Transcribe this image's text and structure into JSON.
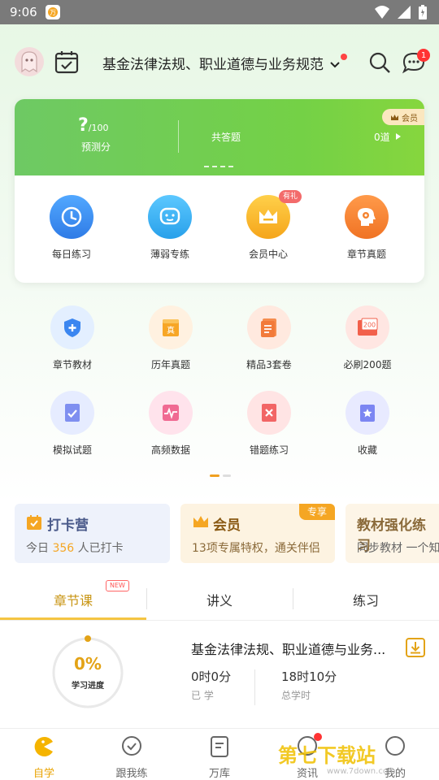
{
  "status_bar": {
    "time": "9:06"
  },
  "header": {
    "subject": "基金法律法规、职业道德与业务规范",
    "message_badge": "1"
  },
  "exam_card": {
    "score": "?",
    "score_max": "/100",
    "score_label": "预测分",
    "answered_label": "共答题",
    "answered_count": "0道",
    "vip_tag": "会员",
    "accent": "#74d146"
  },
  "quick_actions": [
    {
      "label": "每日练习",
      "icon": "clock-icon",
      "color": "#3a8ff0"
    },
    {
      "label": "薄弱专练",
      "icon": "chat-face-icon",
      "color": "#35aef0"
    },
    {
      "label": "会员中心",
      "icon": "crown-icon",
      "color": "#f5b421",
      "badge": "有礼"
    },
    {
      "label": "章节真题",
      "icon": "gear-head-icon",
      "color": "#f5832f"
    }
  ],
  "grid": [
    {
      "label": "章节教材",
      "icon": "shield-plus-icon"
    },
    {
      "label": "历年真题",
      "icon": "folder-zhen-icon"
    },
    {
      "label": "精品3套卷",
      "icon": "paper-list-icon"
    },
    {
      "label": "必刷200题",
      "icon": "board-200-icon"
    },
    {
      "label": "模拟试题",
      "icon": "check-doc-icon"
    },
    {
      "label": "高频数据",
      "icon": "pulse-box-icon"
    },
    {
      "label": "错题练习",
      "icon": "x-doc-icon"
    },
    {
      "label": "收藏",
      "icon": "star-icon"
    }
  ],
  "promos": [
    {
      "title": "打卡营",
      "sub_pre": "今日",
      "sub_num": "356",
      "sub_post": "人已打卡"
    },
    {
      "title": "会员",
      "sub": "13项专属特权，通关伴侣",
      "tag": "专享"
    },
    {
      "title": "教材强化练习",
      "sub": "同步教材 一个知"
    }
  ],
  "tabs": [
    {
      "label": "章节课",
      "badge": "NEW"
    },
    {
      "label": "讲义"
    },
    {
      "label": "练习"
    }
  ],
  "course": {
    "progress_pct": "0%",
    "progress_label": "学习进度",
    "title": "基金法律法规、职业道德与业务...",
    "studied_value": "0时0分",
    "studied_label": "已 学",
    "total_value": "18时10分",
    "total_label": "总学时"
  },
  "bottom_nav": [
    {
      "label": "自学",
      "icon": "pacman-icon"
    },
    {
      "label": "跟我练",
      "icon": "check-circle-icon"
    },
    {
      "label": "万库",
      "icon": "doc-icon"
    },
    {
      "label": "资讯",
      "icon": "info-icon"
    },
    {
      "label": "我的",
      "icon": "person-icon"
    }
  ],
  "watermark": {
    "text": "第七下载站",
    "url": "www.7down.com"
  }
}
